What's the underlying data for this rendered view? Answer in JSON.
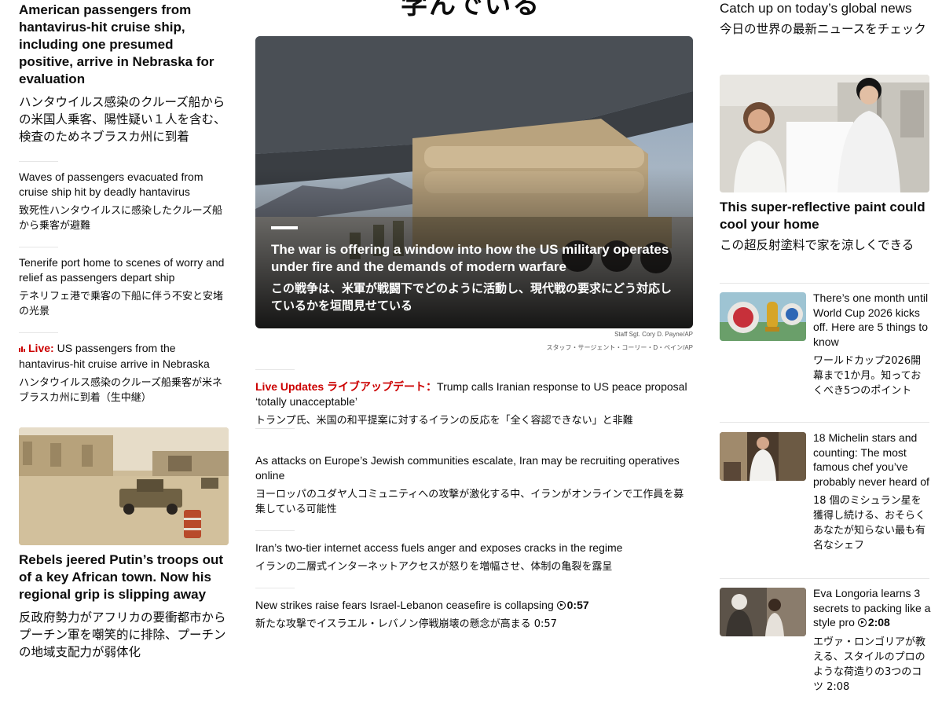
{
  "top_headline_partial": "学んでいる",
  "left": {
    "lead": {
      "title_en": "American passengers from hantavirus-hit cruise ship, including one presumed positive, arrive in Nebraska for evaluation",
      "title_ja": "ハンタウイルス感染のクルーズ船からの米国人乗客、陽性疑い１人を含む、検査のためネブラスカ州に到着"
    },
    "items": [
      {
        "en": "Waves of passengers evacuated from cruise ship hit by deadly hantavirus",
        "ja": "致死性ハンタウイルスに感染したクルーズ船から乗客が避難"
      },
      {
        "en": "Tenerife port home to scenes of worry and relief as passengers depart ship",
        "ja": "テネリフェ港で乗客の下船に伴う不安と安堵の光景"
      },
      {
        "live_label": "Live:",
        "en": "US passengers from the hantavirus-hit cruise arrive in Nebraska",
        "ja": "ハンタウイルス感染のクルーズ船乗客が米ネブラスカ州に到着（生中継）"
      }
    ],
    "story2": {
      "title_en": "Rebels jeered Putin’s troops out of a key African town. Now his regional grip is slipping away",
      "title_ja": "反政府勢力がアフリカの要衝都市からプーチン軍を嘲笑的に排除、プーチンの地域支配力が弱体化"
    }
  },
  "center": {
    "hero": {
      "title_en": "The war is offering a window into how the US military operates under fire and the demands of modern warfare",
      "title_ja": "この戦争は、米軍が戦闘下でどのように活動し、現代戦の要求にどう対応しているかを垣間見せている",
      "credit_en": "Staff Sgt. Cory D. Payne/AP",
      "credit_ja": "スタッフ・サージェント・コーリー・D・ペイン/AP"
    },
    "items": [
      {
        "live_en": "Live Updates",
        "live_ja": "ライブアップデート：",
        "en": "Trump calls Iranian response to US peace proposal ‘totally unacceptable’",
        "ja": "トランプ氏、米国の和平提案に対するイランの反応を「全く容認できない」と非難"
      },
      {
        "en": "As attacks on Europe’s Jewish communities escalate, Iran may be recruiting operatives online",
        "ja": "ヨーロッパのユダヤ人コミュニティへの攻撃が激化する中、イランがオンラインで工作員を募集している可能性"
      },
      {
        "en": "Iran’s two-tier internet access fuels anger and exposes cracks in the regime",
        "ja": "イランの二層式インターネットアクセスが怒りを増幅させ、体制の亀裂を露呈"
      },
      {
        "en": "New strikes raise fears Israel-Lebanon ceasefire is collapsing",
        "duration": "0:57",
        "ja": "新たな攻撃でイスラエル・レバノン停戦崩壊の懸念が高まる 0:57"
      }
    ]
  },
  "right": {
    "section_title_en": "Catch up on today’s global news",
    "section_title_ja": "今日の世界の最新ニュースをチェック",
    "feature": {
      "title_en": "This super-reflective paint could cool your home",
      "title_ja": "この超反射塗料で家を涼しくできる"
    },
    "items": [
      {
        "en": "There’s one month until World Cup 2026 kicks off. Here are 5 things to know",
        "ja": "ワールドカップ2026開幕まで1か月。知っておくべき5つのポイント"
      },
      {
        "en": "18 Michelin stars and counting: The most famous chef you’ve probably never heard of",
        "ja": "18 個のミシュラン星を獲得し続ける、おそらくあなたが知らない最も有名なシェフ"
      },
      {
        "en": "Eva Longoria learns 3 secrets to packing like a style pro",
        "duration": "2:08",
        "ja": "エヴァ・ロンゴリアが教える、スタイルのプロのような荷造りの3つのコツ 2:08"
      }
    ]
  }
}
